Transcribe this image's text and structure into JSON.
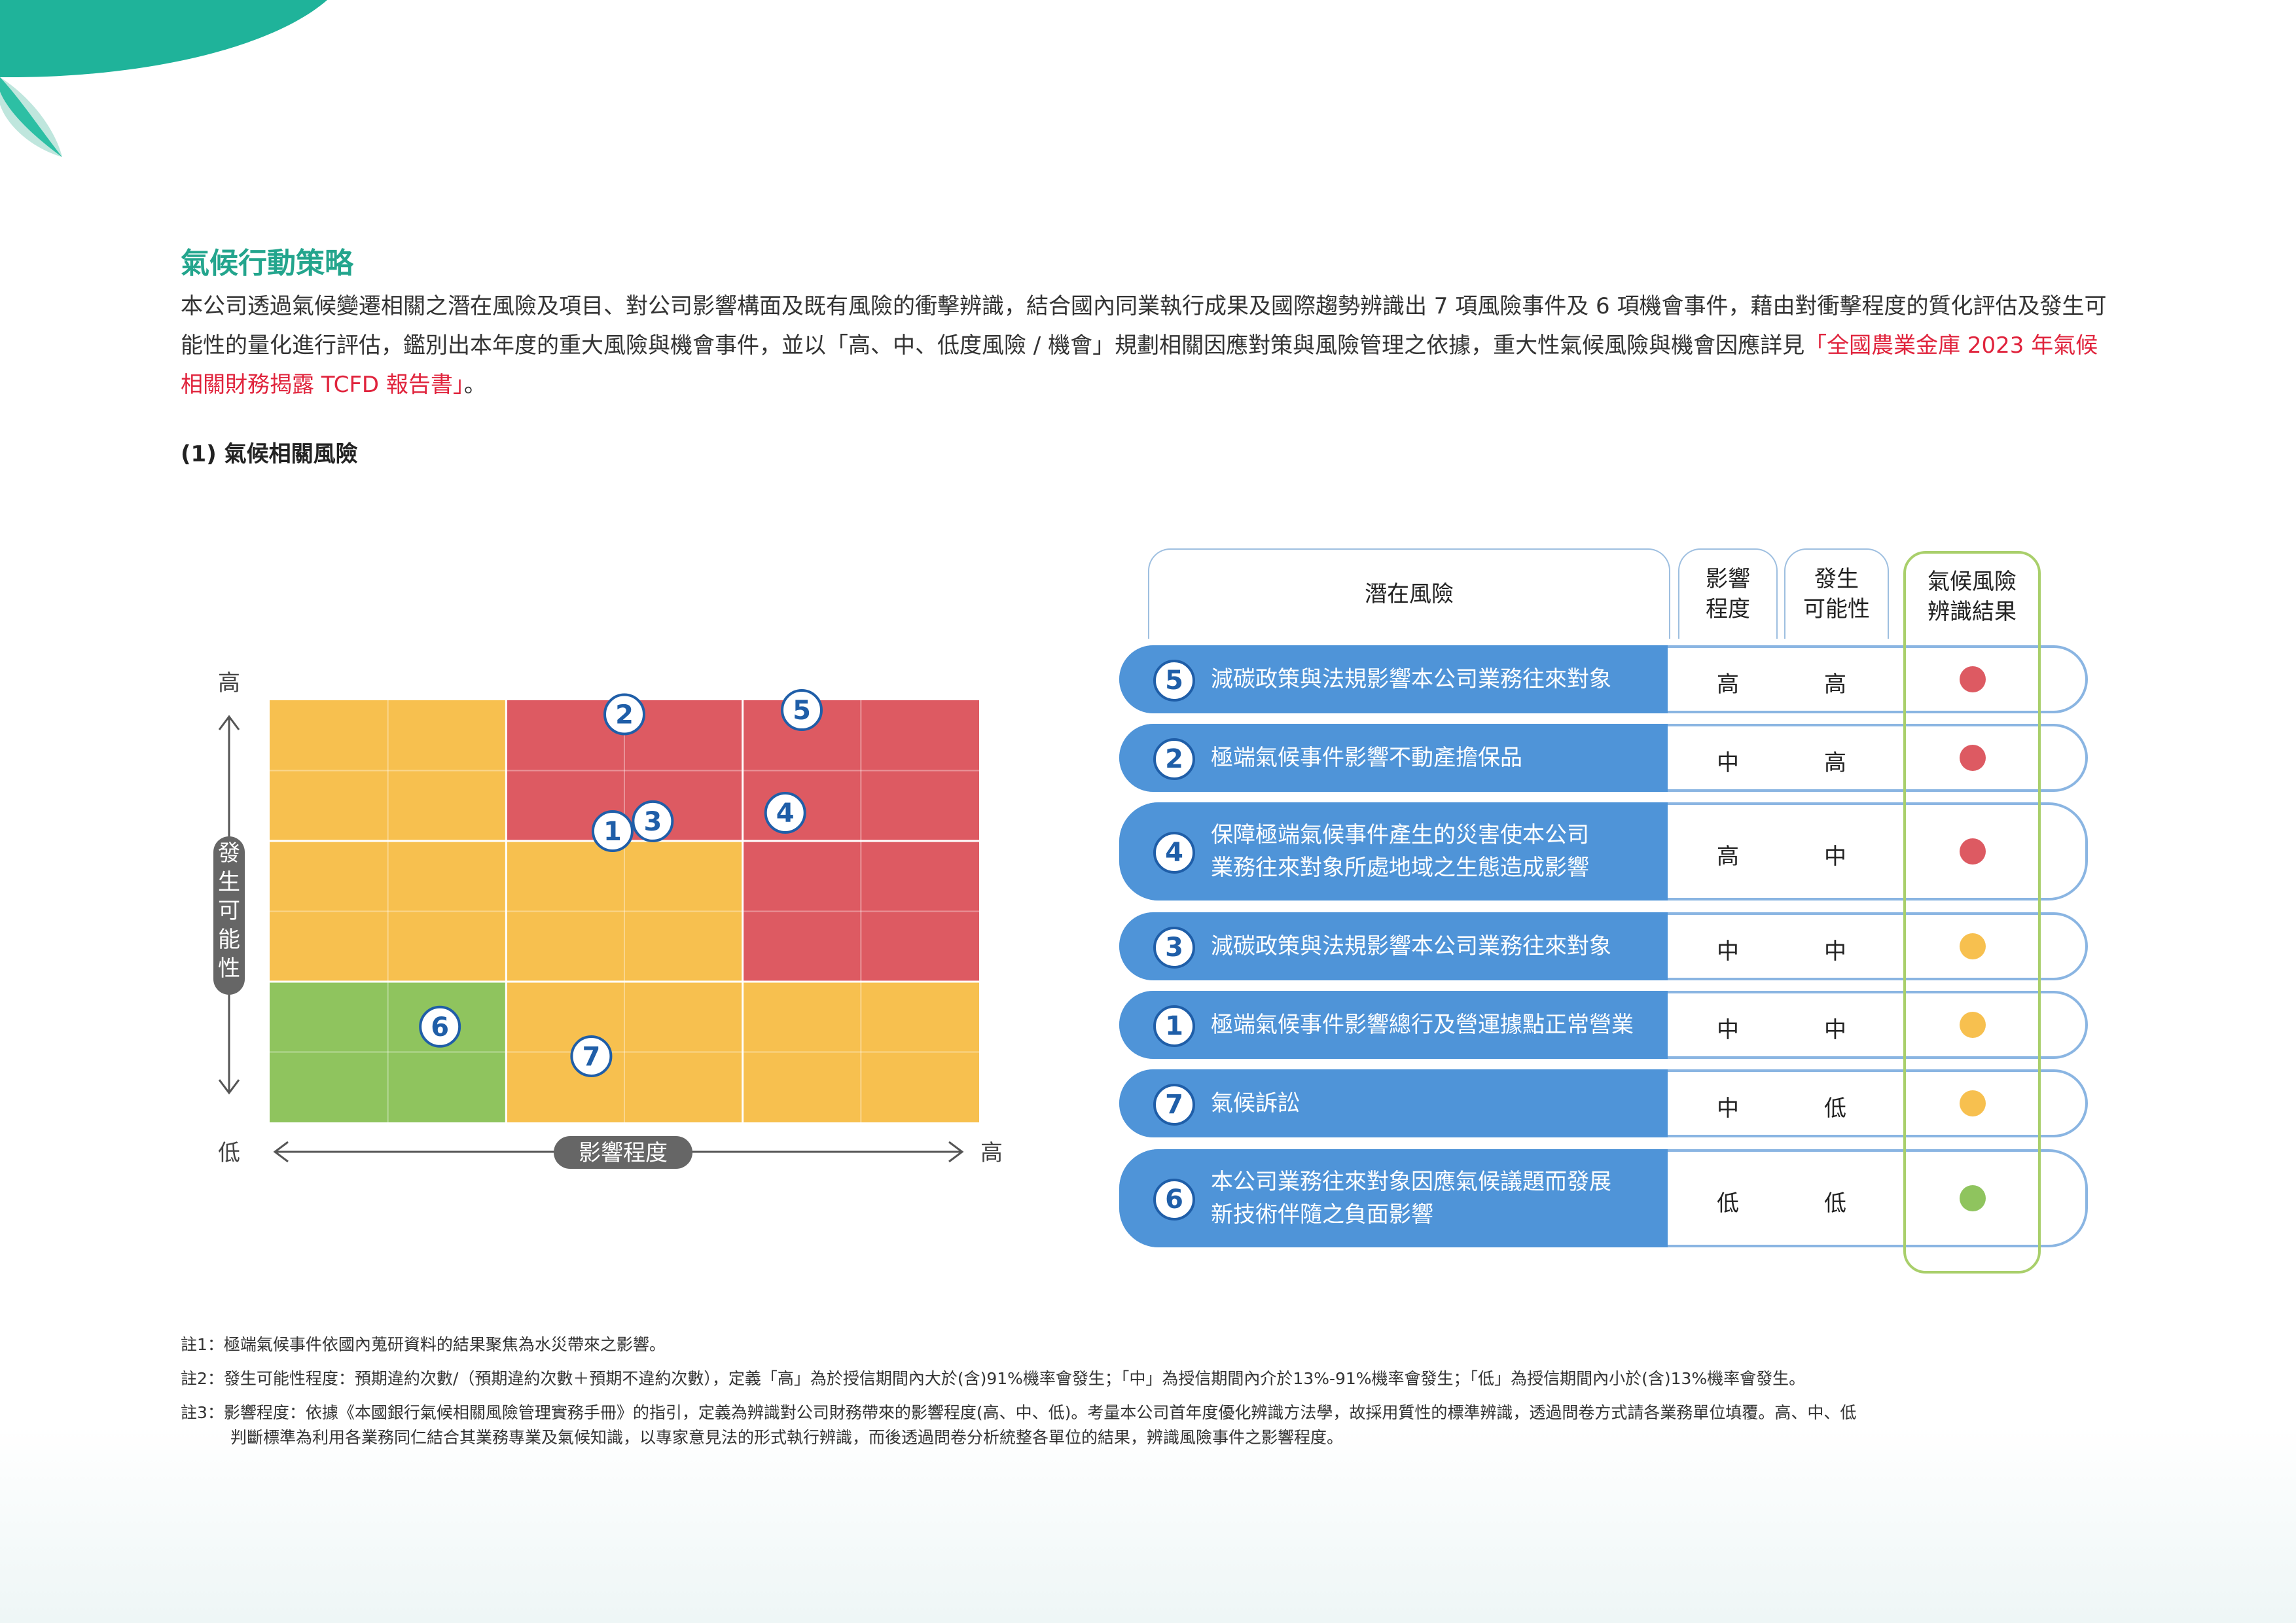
{
  "colors": {
    "accent": "#23a58d",
    "link": "#e0233c",
    "high": "#dd5a62",
    "medium": "#f7c04f",
    "low": "#8fc45e",
    "row_blue": "#4f94d8",
    "result_frame": "#a9cf6b"
  },
  "section_title": "氣候行動策略",
  "intro": {
    "text": "本公司透過氣候變遷相關之潛在風險及項目、對公司影響構面及既有風險的衝擊辨識，結合國內同業執行成果及國際趨勢辨識出 7 項風險事件及 6 項機會事件，藉由對衝擊程度的質化評估及發生可能性的量化進行評估，鑑別出本年度的重大風險與機會事件，並以「高、中、低度風險 / 機會」規劃相關因應對策與風險管理之依據，重大性氣候風險與機會因應詳見",
    "link": "「全國農業金庫 2023 年氣候相關財務揭露 TCFD 報告書」",
    "end": "。"
  },
  "subheading": "(1) 氣候相關風險",
  "matrix": {
    "y_axis_label": "發生可能性",
    "x_axis_label": "影響程度",
    "y_high": "高",
    "y_low": "低",
    "x_low": "低",
    "x_high": "高",
    "grid_colors": [
      [
        "medium",
        "high",
        "high"
      ],
      [
        "medium",
        "medium",
        "high"
      ],
      [
        "low",
        "medium",
        "medium"
      ]
    ],
    "points": [
      {
        "id": "2",
        "impact": 1.5,
        "likelihood": 2.9
      },
      {
        "id": "5",
        "impact": 2.25,
        "likelihood": 2.93
      },
      {
        "id": "1",
        "impact": 1.45,
        "likelihood": 2.07
      },
      {
        "id": "3",
        "impact": 1.62,
        "likelihood": 2.14
      },
      {
        "id": "4",
        "impact": 2.18,
        "likelihood": 2.2
      },
      {
        "id": "6",
        "impact": 0.72,
        "likelihood": 0.68
      },
      {
        "id": "7",
        "impact": 1.36,
        "likelihood": 0.47
      }
    ]
  },
  "table": {
    "headers": {
      "risk": "潛在風險",
      "impact": [
        "影響",
        "程度"
      ],
      "likelihood": [
        "發生",
        "可能性"
      ],
      "result": [
        "氣候風險",
        "辨識結果"
      ]
    },
    "rows": [
      {
        "id": "5",
        "lines": [
          "減碳政策與法規影響本公司業務往來對象"
        ],
        "impact": "高",
        "likelihood": "高",
        "result": "high"
      },
      {
        "id": "2",
        "lines": [
          "極端氣候事件影響不動產擔保品"
        ],
        "impact": "中",
        "likelihood": "高",
        "result": "high"
      },
      {
        "id": "4",
        "lines": [
          "保障極端氣候事件產生的災害使本公司",
          "業務往來對象所處地域之生態造成影響"
        ],
        "impact": "高",
        "likelihood": "中",
        "result": "high"
      },
      {
        "id": "3",
        "lines": [
          "減碳政策與法規影響本公司業務往來對象"
        ],
        "impact": "中",
        "likelihood": "中",
        "result": "medium"
      },
      {
        "id": "1",
        "lines": [
          "極端氣候事件影響總行及營運據點正常營業"
        ],
        "impact": "中",
        "likelihood": "中",
        "result": "medium"
      },
      {
        "id": "7",
        "lines": [
          "氣候訴訟"
        ],
        "impact": "中",
        "likelihood": "低",
        "result": "medium"
      },
      {
        "id": "6",
        "lines": [
          "本公司業務往來對象因應氣候議題而發展",
          "新技術伴隨之負面影響"
        ],
        "impact": "低",
        "likelihood": "低",
        "result": "low"
      }
    ]
  },
  "notes": {
    "n1": "註1：極端氣候事件依國內蒐研資料的結果聚焦為水災帶來之影響。",
    "n2": "註2：發生可能性程度：預期違約次數/（預期違約次數＋預期不違約次數），定義「高」為於授信期間內大於(含)91%機率會發生；「中」為授信期間內介於13%-91%機率會發生；「低」為授信期間內小於(含)13%機率會發生。",
    "n3a": "註3：影響程度：依據《本國銀行氣候相關風險管理實務手冊》的指引，定義為辨識對公司財務帶來的影響程度(高、中、低)。考量本公司首年度優化辨識方法學，故採用質性的標準辨識，透過問卷方式請各業務單位填覆。高、中、低",
    "n3b": "判斷標準為利用各業務同仁結合其業務專業及氣候知識，以專家意見法的形式執行辨識，而後透過問卷分析統整各單位的結果，辨識風險事件之影響程度。"
  }
}
